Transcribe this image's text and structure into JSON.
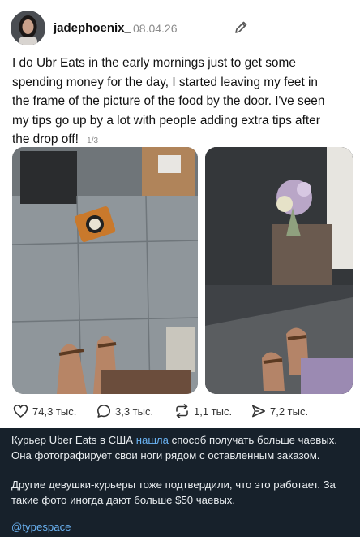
{
  "post": {
    "username": "jadephoenix_",
    "date": "08.04.26",
    "text": "I do Ubr Eats in the early mornings just to get some spending money for the day, I started leaving my feet in the frame of the picture of the food by the door. I've seen my tips go up by a lot with people adding extra tips after the drop off!",
    "page_indicator": "1/3",
    "icons": {
      "edit": "pencil-icon",
      "like": "heart-icon",
      "reply": "speech-bubble-icon",
      "repost": "repost-icon",
      "share": "paper-plane-icon"
    },
    "stats": {
      "likes": "74,3 тыс.",
      "replies": "3,3 тыс.",
      "reposts": "1,1 тыс.",
      "shares": "7,2 тыс."
    }
  },
  "caption": {
    "line1_before": "Курьер Uber Eats в США ",
    "line1_link": "нашла",
    "line1_after": " способ получать больше чаевых. Она фотографирует свои ноги рядом с оставленным заказом.",
    "line2": "Другие девушки-курьеры тоже подтвердили, что это работает. За такие фото иногда дают больше $50 чаевых.",
    "tag": "@typespace"
  },
  "colors": {
    "card_bg": "#ffffff",
    "channel_bg": "#17212b",
    "link": "#6ab2f2"
  }
}
